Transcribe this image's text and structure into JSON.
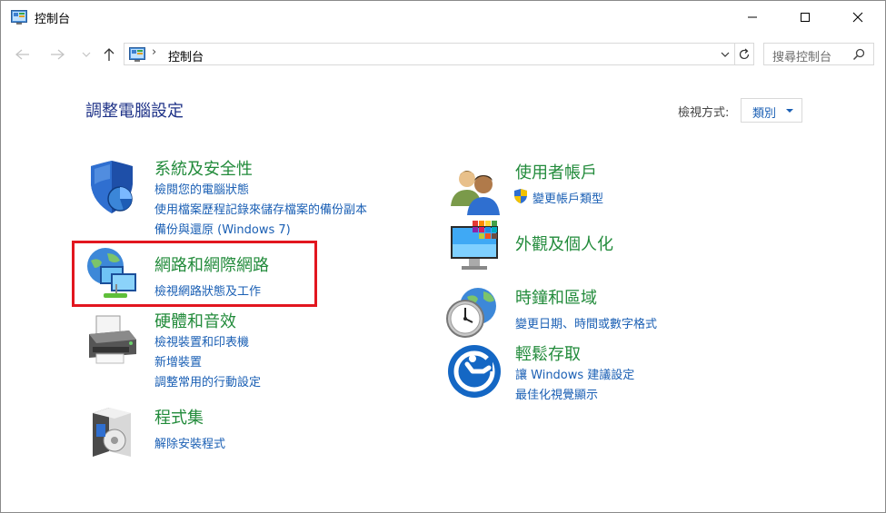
{
  "window": {
    "title": "控制台"
  },
  "address": {
    "path": "控制台",
    "search_placeholder": "搜尋控制台"
  },
  "header": {
    "title": "調整電腦設定",
    "view_by_label": "檢視方式:",
    "view_by_value": "類別"
  },
  "categories": {
    "system": {
      "title": "系統及安全性",
      "links": [
        "檢閱您的電腦狀態",
        "使用檔案歷程記錄來儲存檔案的備份副本",
        "備份與還原 (Windows 7)"
      ]
    },
    "network": {
      "title": "網路和網際網路",
      "links": [
        "檢視網路狀態及工作"
      ]
    },
    "hardware": {
      "title": "硬體和音效",
      "links": [
        "檢視裝置和印表機",
        "新增裝置",
        "調整常用的行動設定"
      ]
    },
    "programs": {
      "title": "程式集",
      "links": [
        "解除安裝程式"
      ]
    },
    "users": {
      "title": "使用者帳戶",
      "links": [
        "變更帳戶類型"
      ]
    },
    "appearance": {
      "title": "外觀及個人化",
      "links": []
    },
    "clock": {
      "title": "時鐘和區域",
      "links": [
        "變更日期、時間或數字格式"
      ]
    },
    "ease": {
      "title": "輕鬆存取",
      "links": [
        "讓 Windows 建議設定",
        "最佳化視覺顯示"
      ]
    }
  },
  "colors": {
    "category_title": "#228b3b",
    "link": "#1a5fb4",
    "page_title": "#1e3287",
    "highlight": "#e2161f"
  }
}
